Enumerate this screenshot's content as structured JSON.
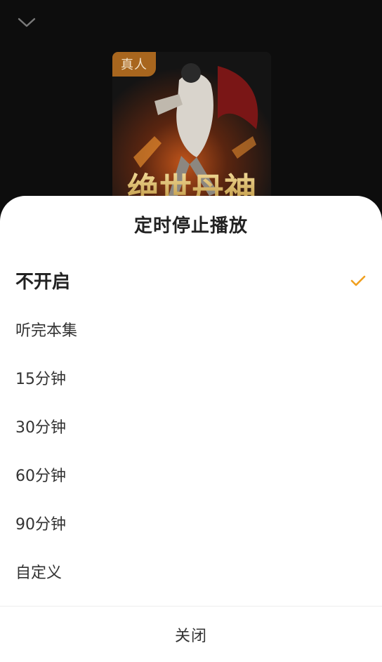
{
  "header": {
    "collapse_icon": "chevron-down-icon"
  },
  "cover": {
    "badge": "真人",
    "title_art_text": "绝世丹神"
  },
  "timer_sheet": {
    "title": "定时停止播放",
    "options": [
      {
        "label": "不开启",
        "selected": true
      },
      {
        "label": "听完本集",
        "selected": false
      },
      {
        "label": "15分钟",
        "selected": false
      },
      {
        "label": "30分钟",
        "selected": false
      },
      {
        "label": "60分钟",
        "selected": false
      },
      {
        "label": "90分钟",
        "selected": false
      },
      {
        "label": "自定义",
        "selected": false
      }
    ],
    "check_icon": "checkmark-icon",
    "close_label": "关闭"
  },
  "colors": {
    "accent": "#f0a020",
    "badge_bg": "#a8661e",
    "backdrop": "#0d0d0d",
    "sheet_bg": "#ffffff"
  }
}
